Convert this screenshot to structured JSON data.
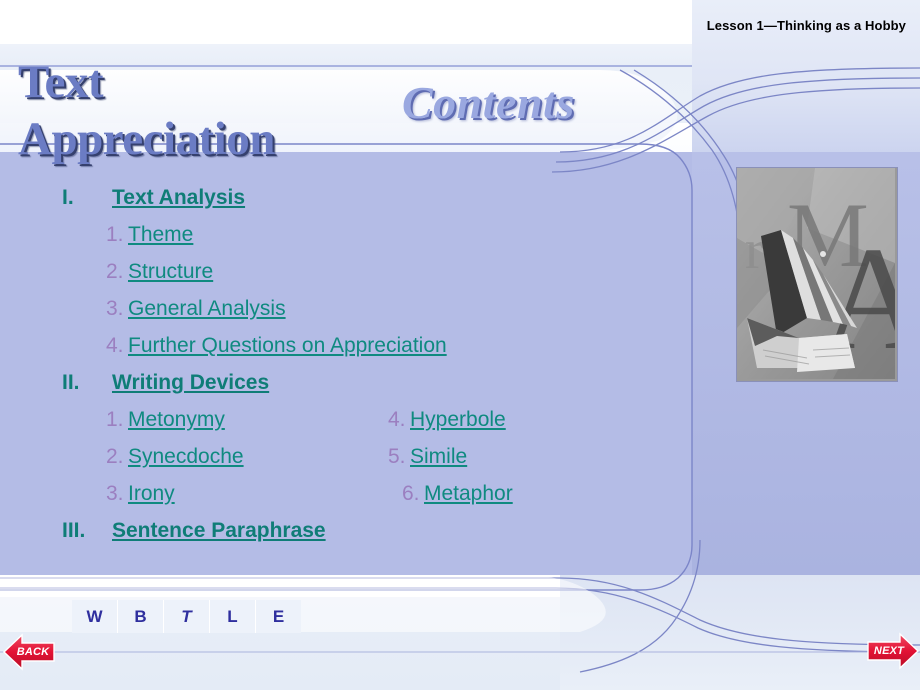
{
  "header": {
    "lesson": "Lesson 1—Thinking as a Hobby"
  },
  "titles": {
    "main_line1": "Text",
    "main_line2": "Appreciation",
    "contents": "Contents"
  },
  "colors": {
    "panel_lavender": "#b4bce6",
    "title_blue": "#6b7cc4",
    "contents_blue": "#9aa8e0",
    "link_teal": "#0f8a80",
    "heading_teal": "#0f7d77",
    "number_purple": "#9b7fc0",
    "arrow_red": "#e8213f",
    "wbtle_navy": "#2f2f9e"
  },
  "toc": {
    "sections": [
      {
        "roman": "I.",
        "title": "Text Analysis ",
        "items_col_a": [
          {
            "num": "1.",
            "label": "Theme"
          },
          {
            "num": "2.",
            "label": "Structure"
          },
          {
            "num": "3.",
            "label": "General Analysis"
          },
          {
            "num": "4.",
            "label": "Further Questions on Appreciation"
          }
        ],
        "items_col_b": []
      },
      {
        "roman": "II.",
        "title": "Writing Devices",
        "items_col_a": [
          {
            "num": "1.",
            "label": "Metonymy"
          },
          {
            "num": "2.",
            "label": "Synecdoche"
          },
          {
            "num": "3.",
            "label": "Irony"
          }
        ],
        "items_col_b": [
          {
            "num": "4.",
            "label": "Hyperbole"
          },
          {
            "num": "5.",
            "label": "Simile"
          },
          {
            "num": "6.",
            "label": "Metaphor"
          }
        ]
      },
      {
        "roman": "III.",
        "title": "Sentence Paraphrase",
        "items_col_a": [],
        "items_col_b": []
      }
    ]
  },
  "toolbar": {
    "buttons": [
      {
        "label": "W",
        "italic": false
      },
      {
        "label": "B",
        "italic": false
      },
      {
        "label": "T",
        "italic": true
      },
      {
        "label": "L",
        "italic": false
      },
      {
        "label": "E",
        "italic": false
      }
    ]
  },
  "nav": {
    "back_label": "BACK",
    "next_label": "NEXT"
  },
  "picture": {
    "alt": "grayscale open book with overlaid letters",
    "overlay_letters": [
      "r",
      "M",
      "A"
    ]
  }
}
